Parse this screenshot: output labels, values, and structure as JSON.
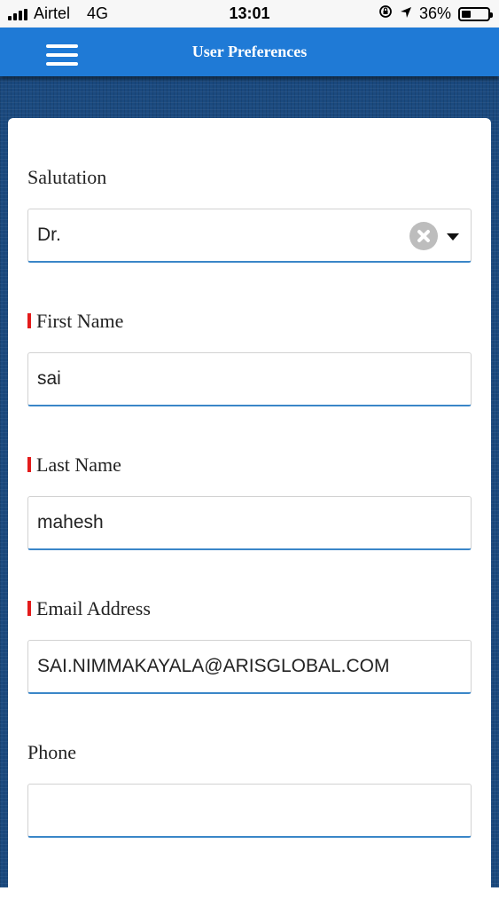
{
  "status_bar": {
    "carrier": "Airtel",
    "network": "4G",
    "time": "13:01",
    "battery_percent": "36%",
    "battery_level": 0.36,
    "icons": [
      "signal-icon",
      "lock-rotation-icon",
      "location-arrow-icon",
      "battery-icon"
    ]
  },
  "header": {
    "title": "User Preferences",
    "menu_icon": "hamburger-menu-icon"
  },
  "form": {
    "salutation": {
      "label": "Salutation",
      "value": "Dr.",
      "clear_icon": "clear-icon",
      "dropdown_icon": "chevron-down-icon"
    },
    "first_name": {
      "label": "First Name",
      "value": "sai",
      "required": true
    },
    "last_name": {
      "label": "Last Name",
      "value": "mahesh",
      "required": true
    },
    "email": {
      "label": "Email Address",
      "value": "SAI.NIMMAKAYALA@ARISGLOBAL.COM",
      "required": true
    },
    "phone": {
      "label": "Phone",
      "value": ""
    }
  },
  "colors": {
    "header_bg": "#1f7ad6",
    "page_bg": "#1b4a7f",
    "required_marker": "#e31b1b",
    "input_underline": "#3a86c8"
  }
}
